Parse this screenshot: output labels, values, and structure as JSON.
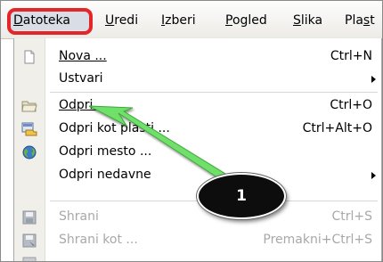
{
  "menubar": {
    "items": [
      {
        "label": "Datoteka"
      },
      {
        "label": "Uredi"
      },
      {
        "label": "Izberi"
      },
      {
        "label": "Pogled"
      },
      {
        "label": "Slika"
      },
      {
        "label": "Plast"
      }
    ]
  },
  "file_menu": {
    "items": [
      {
        "label": "Nova ...",
        "accel": "Ctrl+N",
        "icon": "new-document-icon",
        "enabled": true
      },
      {
        "label": "Ustvari",
        "accel": "",
        "icon": "",
        "enabled": true,
        "submenu": true
      },
      {
        "label": "Odpri ...",
        "accel": "Ctrl+O",
        "icon": "open-folder-icon",
        "enabled": true
      },
      {
        "label": "Odpri kot plasti ...",
        "accel": "Ctrl+Alt+O",
        "icon": "open-as-layers-icon",
        "enabled": true
      },
      {
        "label": "Odpri mesto ...",
        "accel": "",
        "icon": "globe-icon",
        "enabled": true
      },
      {
        "label": "Odpri nedavne",
        "accel": "",
        "icon": "",
        "enabled": true,
        "submenu": true
      },
      {
        "label": "Shrani",
        "accel": "Ctrl+S",
        "icon": "save-icon",
        "enabled": false
      },
      {
        "label": "Shrani kot ...",
        "accel": "Premakni+Ctrl+S",
        "icon": "save-as-icon",
        "enabled": false
      }
    ]
  },
  "annotation": {
    "step_number": "1",
    "highlight_color": "#e3262a",
    "arrow_color": "#6fe06a"
  }
}
